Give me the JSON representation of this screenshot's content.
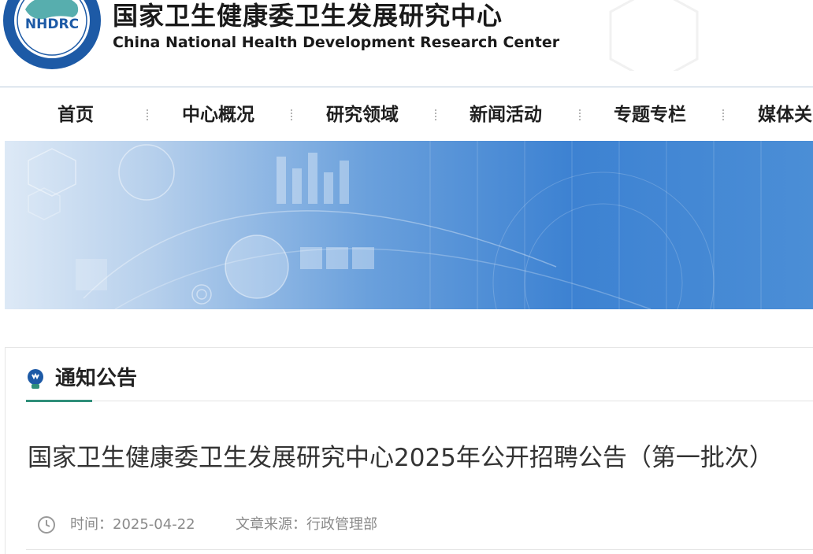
{
  "header": {
    "logo_text": "NHDRC",
    "title_cn": "国家卫生健康委卫生发展研究中心",
    "title_en": "China National Health Development Research Center"
  },
  "nav": {
    "items": [
      "首页",
      "中心概况",
      "研究领域",
      "新闻活动",
      "专题专栏",
      "媒体关"
    ]
  },
  "section": {
    "title": "通知公告",
    "icon": "lightbulb-icon"
  },
  "article": {
    "title": "国家卫生健康委卫生发展研究中心2025年公开招聘公告（第一批次）",
    "time_label": "时间：",
    "time_value": "2025-04-22",
    "source_label": "文章来源：",
    "source_value": "行政管理部"
  },
  "colors": {
    "accent": "#2f8f7a",
    "logo_blue": "#1d5aa6",
    "banner_blue": "#3d82d2"
  }
}
